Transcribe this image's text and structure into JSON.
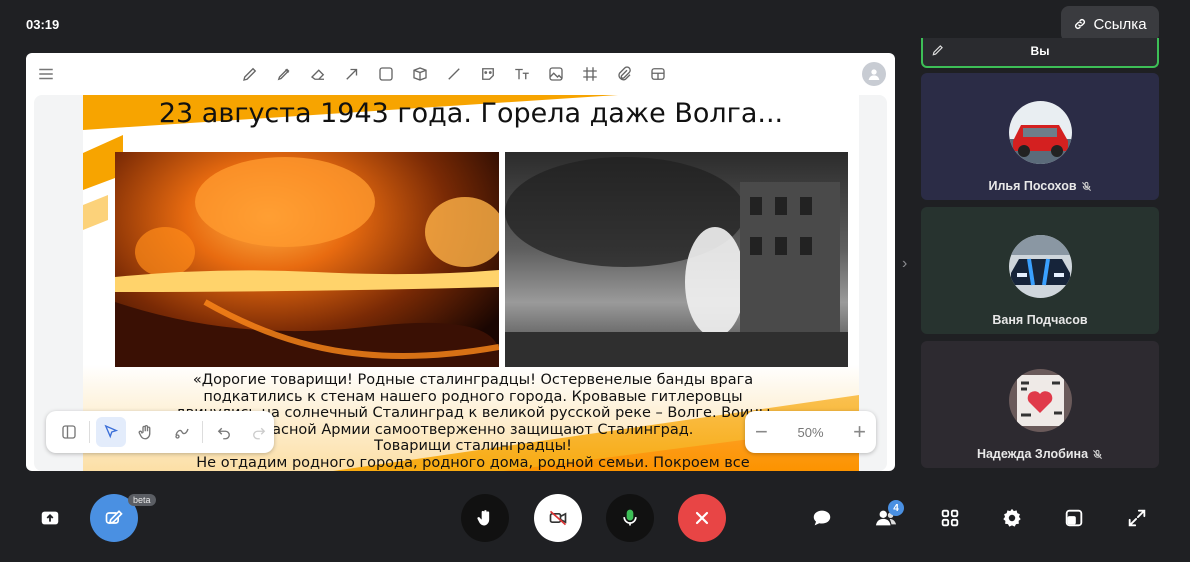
{
  "header": {
    "timer": "03:19",
    "link_label": "Ссылка"
  },
  "slide": {
    "title": "23 августа 1943 года. Горела даже Волга...",
    "text_lines": [
      "«Дорогие товарищи! Родные сталинградцы! Остервенелые банды врага",
      "подкатились к стенам нашего родного города. Кровавые гитлеровцы",
      "двинулись на солнечный Сталинград к великой русской реке – Волге. Воины",
      "Красной Армии самоотверженно защищают Сталинград.",
      "Товарищи сталинградцы!",
      "Не отдадим родного города, родного дома, родной семьи. Покроем все"
    ],
    "accent_color": "#f7a400"
  },
  "zoom": {
    "value": "50%"
  },
  "participants": {
    "self_name": "Вы",
    "items": [
      {
        "name": "Илья Посохов",
        "muted": true
      },
      {
        "name": "Ваня Подчасов",
        "muted": false
      },
      {
        "name": "Надежда Злобина",
        "muted": true
      }
    ]
  },
  "bottom": {
    "beta_label": "beta",
    "participants_count": "4",
    "end_call_color": "#e84545",
    "whiteboard_color": "#4a90e2"
  }
}
